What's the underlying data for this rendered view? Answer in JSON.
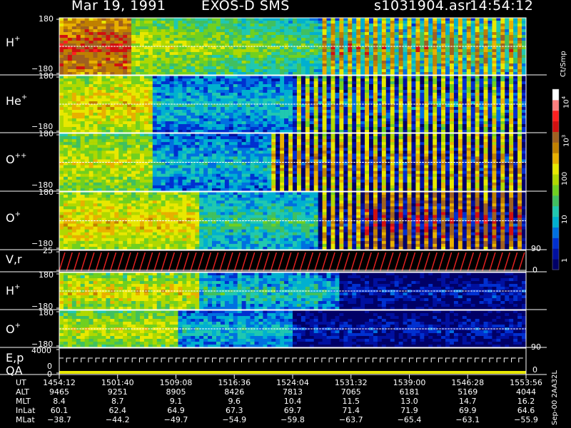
{
  "header": {
    "date": "Mar 19, 1991",
    "instrument": "EXOS-D SMS",
    "file": "s1031904.asr",
    "time": "14:54:12"
  },
  "colors": {
    "palette": [
      "#000066",
      "#0010a0",
      "#0030d0",
      "#0070e0",
      "#00b0d0",
      "#20c8b0",
      "#40c060",
      "#70d020",
      "#b0d800",
      "#e8e800",
      "#e8b000",
      "#c08000",
      "#a06020",
      "#d01010",
      "#ff2020",
      "#ff8080",
      "#ffffff"
    ]
  },
  "panels": [
    {
      "name": "H+",
      "base": "H",
      "sup": "+",
      "ymax": "180",
      "ymin": "−180"
    },
    {
      "name": "He+",
      "base": "He",
      "sup": "+",
      "ymax": "180",
      "ymin": "−180"
    },
    {
      "name": "O++",
      "base": "O",
      "sup": "++",
      "ymax": "180",
      "ymin": "−180"
    },
    {
      "name": "O+",
      "base": "O",
      "sup": "+",
      "ymax": "180",
      "ymin": "−180"
    },
    {
      "name": "V,r",
      "base": "V,r",
      "sup": "",
      "ymax": "25",
      "ymin": "",
      "right_top": "90",
      "right_bot": "0"
    },
    {
      "name": "H+",
      "base": "H",
      "sup": "+",
      "ymax": "180",
      "ymin": "−180"
    },
    {
      "name": "O+",
      "base": "O",
      "sup": "+",
      "ymax": "180",
      "ymin": "−180"
    },
    {
      "name": "E,p QA",
      "base": "E,p",
      "sub2": "QA",
      "ymax": "4000",
      "ymin": "0",
      "ymin2": "0",
      "right_top": "90",
      "right_bot": "0"
    }
  ],
  "colorbar": {
    "unit": "Ct/Smp",
    "ticks": [
      "10",
      "3",
      "100",
      "10",
      "1"
    ],
    "exponent_ticks": [
      "4",
      "3"
    ],
    "labels_plain": [
      "100",
      "10",
      "1"
    ]
  },
  "footer": {
    "version": "Sep-00  2AA32L",
    "rows": [
      {
        "label": "UT",
        "values": [
          "1454:12",
          "1501:40",
          "1509:08",
          "1516:36",
          "1524:04",
          "1531:32",
          "1539:00",
          "1546:28",
          "1553:56"
        ]
      },
      {
        "label": "ALT",
        "values": [
          "9465",
          "9251",
          "8905",
          "8426",
          "7813",
          "7065",
          "6181",
          "5169",
          "4044"
        ]
      },
      {
        "label": "MLT",
        "values": [
          "8.4",
          "8.7",
          "9.1",
          "9.6",
          "10.4",
          "11.5",
          "13.0",
          "14.7",
          "16.2"
        ]
      },
      {
        "label": "InLat",
        "values": [
          "60.1",
          "62.4",
          "64.9",
          "67.3",
          "69.7",
          "71.4",
          "71.9",
          "69.9",
          "64.6"
        ]
      },
      {
        "label": "MLat",
        "values": [
          "−38.7",
          "−44.2",
          "−49.7",
          "−54.9",
          "−59.8",
          "−63.7",
          "−65.4",
          "−63.1",
          "−55.9"
        ]
      }
    ]
  },
  "chart_data": {
    "type": "heatmap",
    "title": "Mar 19, 1991   EXOS-D SMS",
    "x": [
      "1454:12",
      "1501:40",
      "1509:08",
      "1516:36",
      "1524:04",
      "1531:32",
      "1539:00",
      "1546:28",
      "1553:56"
    ],
    "series": [
      {
        "name": "H+",
        "ylim": [
          -180,
          180
        ]
      },
      {
        "name": "He+",
        "ylim": [
          -180,
          180
        ]
      },
      {
        "name": "O++",
        "ylim": [
          -180,
          180
        ]
      },
      {
        "name": "O+",
        "ylim": [
          -180,
          180
        ]
      },
      {
        "name": "V,r",
        "ylim": [
          0,
          25
        ]
      },
      {
        "name": "H+",
        "ylim": [
          -180,
          180
        ]
      },
      {
        "name": "O+",
        "ylim": [
          -180,
          180
        ]
      },
      {
        "name": "E,p QA",
        "ylim": [
          0,
          4000
        ]
      }
    ],
    "colorbar_range": [
      1,
      10000
    ],
    "colorbar_scale": "log"
  }
}
